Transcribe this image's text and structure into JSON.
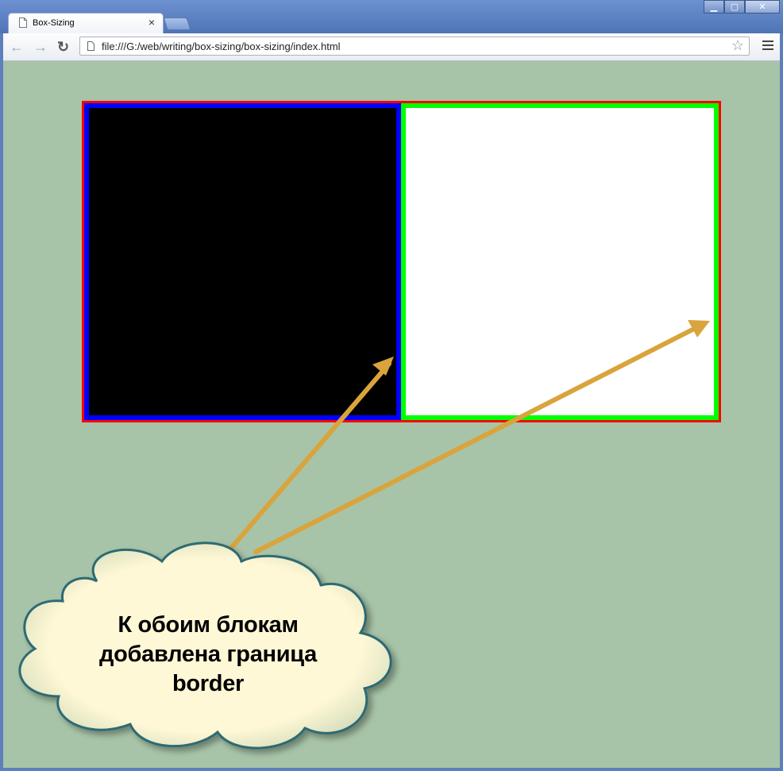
{
  "browser": {
    "tab_title": "Box-Sizing",
    "tab_close": "×",
    "address": "file:///G:/web/writing/box-sizing/box-sizing/index.html",
    "window_controls": [
      "minimize",
      "maximize",
      "close"
    ]
  },
  "page": {
    "background": "#a7c4a8",
    "container_border": "#ff0000",
    "left_box": {
      "fill": "#000000",
      "border": "#0000ff"
    },
    "right_box": {
      "fill": "#ffffff",
      "border": "#00ff00"
    },
    "callout": {
      "line1": "К обоим блокам",
      "line2": "добавлена граница",
      "line3": "border",
      "fill": "#fff8d6",
      "outline": "#2d6a73"
    },
    "arrow_color": "#d9a43c"
  }
}
